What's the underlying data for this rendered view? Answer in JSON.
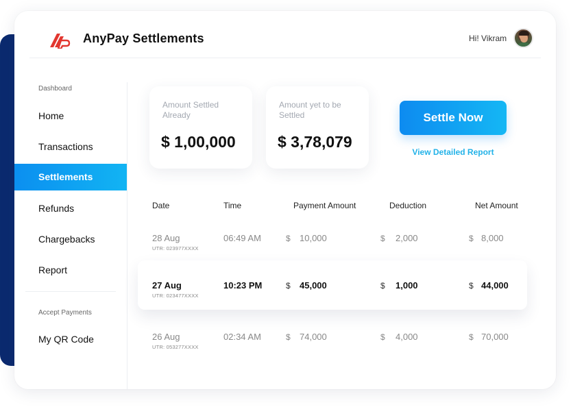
{
  "app": {
    "title": "AnyPay Settlements",
    "greeting": "Hi! Vikram"
  },
  "colors": {
    "brand_red": "#e2362f",
    "accent_blue": "#0d8bf0",
    "accent_cyan": "#15b7f4",
    "navy": "#0b2a6f"
  },
  "icons": {
    "logo": "anypay-logo",
    "avatar": "user-avatar"
  },
  "sidebar": {
    "section_dashboard": "Dashboard",
    "items": [
      {
        "label": "Home",
        "active": false
      },
      {
        "label": "Transactions",
        "active": false
      },
      {
        "label": "Settlements",
        "active": true
      },
      {
        "label": "Refunds",
        "active": false
      },
      {
        "label": "Chargebacks",
        "active": false
      },
      {
        "label": "Report",
        "active": false
      }
    ],
    "section_accept": "Accept Payments",
    "qr_label": "My QR Code"
  },
  "summary": {
    "settled_label": "Amount Settled Already",
    "settled_value": "$ 1,00,000",
    "pending_label": "Amount yet to be Settled",
    "pending_value": "$ 3,78,079",
    "settle_button": "Settle Now",
    "report_link": "View Detailed Report"
  },
  "table": {
    "headers": [
      "Date",
      "Time",
      "Payment Amount",
      "Deduction",
      "Net Amount"
    ],
    "currency": "$",
    "rows": [
      {
        "date": "28 Aug",
        "utr": "UTR: 023977XXXX",
        "time": "06:49 AM",
        "payment": "10,000",
        "deduction": "2,000",
        "net": "8,000",
        "highlight": false
      },
      {
        "date": "27 Aug",
        "utr": "UTR: 023477XXXX",
        "time": "10:23 PM",
        "payment": "45,000",
        "deduction": "1,000",
        "net": "44,000",
        "highlight": true
      },
      {
        "date": "26 Aug",
        "utr": "UTR: 053277XXXX",
        "time": "02:34 AM",
        "payment": "74,000",
        "deduction": "4,000",
        "net": "70,000",
        "highlight": false
      }
    ]
  }
}
